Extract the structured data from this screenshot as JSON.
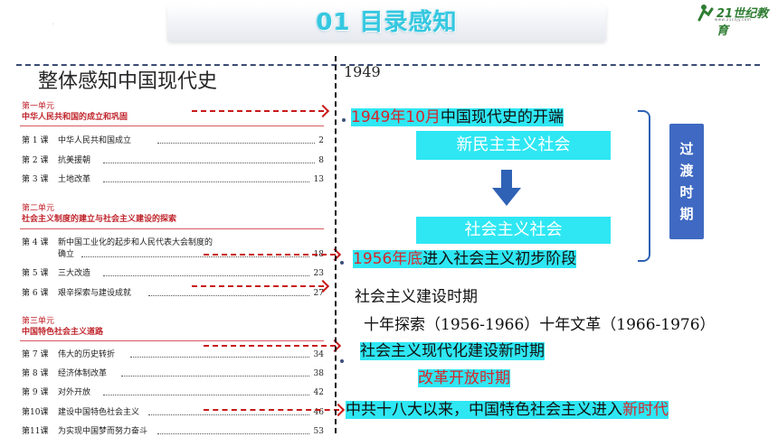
{
  "header": {
    "title": "01 目录感知"
  },
  "logo": {
    "text": "21世纪教育",
    "sub": "www.21cnjy.com"
  },
  "left_panel": {
    "title": "整体感知中国现代史",
    "units": [
      {
        "label": "第一单元",
        "name": "中华人民共和国的成立和巩固"
      },
      {
        "label": "第二单元",
        "name": "社会主义制度的建立与社会主义建设的探索"
      },
      {
        "label": "第三单元",
        "name": "中国特色社会主义道路"
      }
    ],
    "lessons": [
      {
        "num": "第 1 课",
        "title": "中华人民共和国成立",
        "page": "2"
      },
      {
        "num": "第 2 课",
        "title": "抗美援朝",
        "page": "8"
      },
      {
        "num": "第 3 课",
        "title": "土地改革",
        "page": "13"
      },
      {
        "num": "第 4 课",
        "title": "新中国工业化的起步和人民代表大会制度的",
        "cont": "确立",
        "page": "18"
      },
      {
        "num": "第 5 课",
        "title": "三大改造",
        "page": "23"
      },
      {
        "num": "第 6 课",
        "title": "艰辛探索与建设成就",
        "page": "27"
      },
      {
        "num": "第 7 课",
        "title": "伟大的历史转折",
        "page": "34"
      },
      {
        "num": "第 8 课",
        "title": "经济体制改革",
        "page": "38"
      },
      {
        "num": "第 9 课",
        "title": "对外开放",
        "page": "42"
      },
      {
        "num": "第10课",
        "title": "建设中国特色社会主义",
        "page": "46"
      },
      {
        "num": "第11课",
        "title": "为实现中国梦而努力奋斗",
        "page": "53"
      }
    ]
  },
  "timeline": {
    "year_start": "1949",
    "e1_date": "1949年10月",
    "e1_text": "中国现代史的开端",
    "box_new": "新民主主义社会",
    "box_socialist": "社会主义社会",
    "e2_date": "1956年底",
    "e2_text": "进入社会主义初步阶段",
    "transition_period": [
      "过",
      "渡",
      "时",
      "期"
    ],
    "construction": "社会主义建设时期",
    "decades": "十年探索（1956-1966）十年文革（1966-1976）",
    "modernization": "社会主义现代化建设新时期",
    "reform": "改革开放时期",
    "new_era_main": "中共十八大以来，中国特色社会主义进入",
    "new_era_tail": "新时代"
  },
  "colors": {
    "cyan": "#2ee7f3",
    "red": "#d6272d",
    "blue": "#3f69c2",
    "title_cyan": "#35c8e0"
  }
}
